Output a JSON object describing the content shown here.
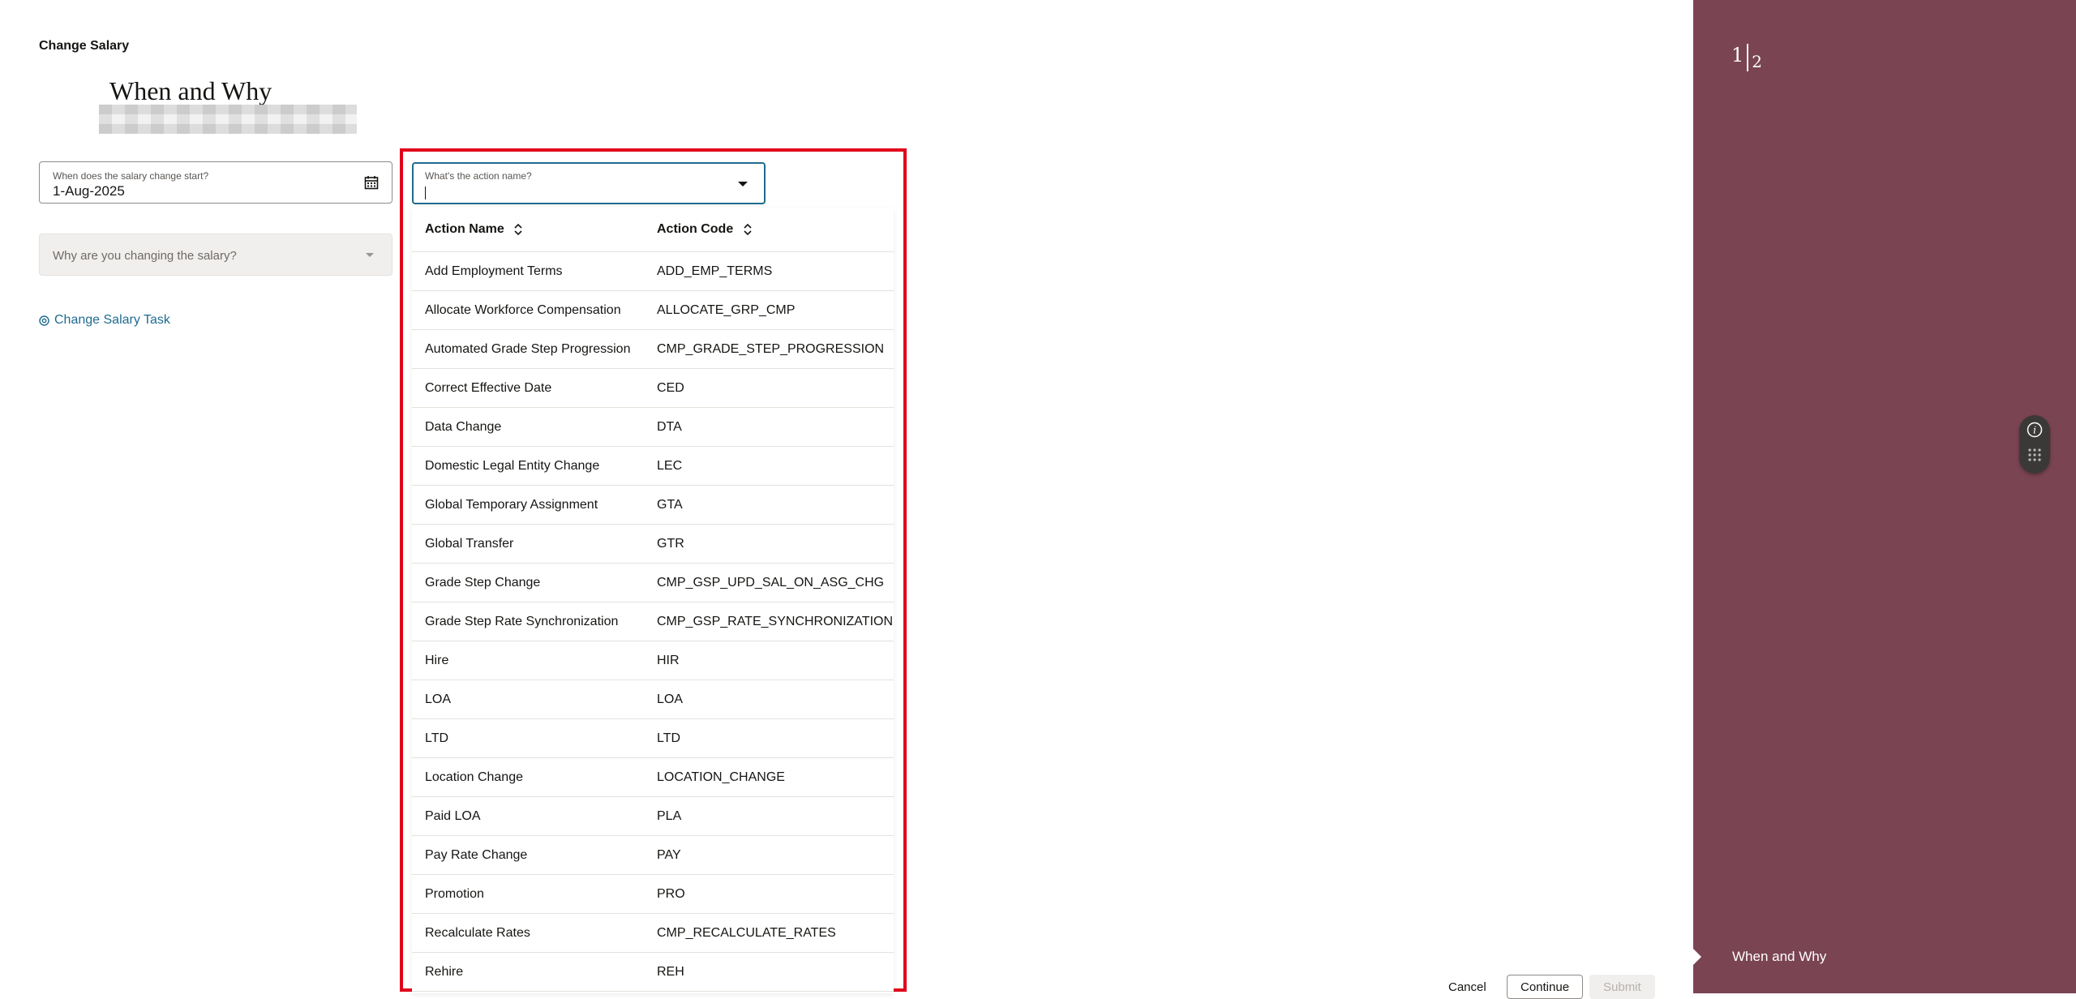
{
  "page": {
    "label": "Change Salary",
    "title": "When and Why"
  },
  "date_field": {
    "label": "When does the salary change start?",
    "value": "1-Aug-2025",
    "icon": "calendar-icon"
  },
  "reason_field": {
    "placeholder": "Why are you changing the salary?"
  },
  "task_link": {
    "label": "Change Salary Task",
    "icon": "task-icon"
  },
  "action_field": {
    "label": "What's the action name?",
    "value": ""
  },
  "action_table": {
    "headers": [
      "Action Name",
      "Action Code"
    ],
    "rows": [
      [
        "Add Employment Terms",
        "ADD_EMP_TERMS"
      ],
      [
        "Allocate Workforce Compensation",
        "ALLOCATE_GRP_CMP"
      ],
      [
        "Automated Grade Step Progression",
        "CMP_GRADE_STEP_PROGRESSION"
      ],
      [
        "Correct Effective Date",
        "CED"
      ],
      [
        "Data Change",
        "DTA"
      ],
      [
        "Domestic Legal Entity Change",
        "LEC"
      ],
      [
        "Global Temporary Assignment",
        "GTA"
      ],
      [
        "Global Transfer",
        "GTR"
      ],
      [
        "Grade Step Change",
        "CMP_GSP_UPD_SAL_ON_ASG_CHG"
      ],
      [
        "Grade Step Rate Synchronization",
        "CMP_GSP_RATE_SYNCHRONIZATION"
      ],
      [
        "Hire",
        "HIR"
      ],
      [
        "LOA",
        "LOA"
      ],
      [
        "LTD",
        "LTD"
      ],
      [
        "Location Change",
        "LOCATION_CHANGE"
      ],
      [
        "Paid LOA",
        "PLA"
      ],
      [
        "Pay Rate Change",
        "PAY"
      ],
      [
        "Promotion",
        "PRO"
      ],
      [
        "Recalculate Rates",
        "CMP_RECALCULATE_RATES"
      ],
      [
        "Rehire",
        "REH"
      ]
    ]
  },
  "sidebar": {
    "step_current": "1",
    "step_total": "2",
    "current_step_label": "When and Why",
    "color": "#7a4453"
  },
  "footer": {
    "cancel": "Cancel",
    "continue": "Continue",
    "submit": "Submit"
  },
  "colors": {
    "accent": "#1f6b8f",
    "highlight": "#e0001b"
  }
}
